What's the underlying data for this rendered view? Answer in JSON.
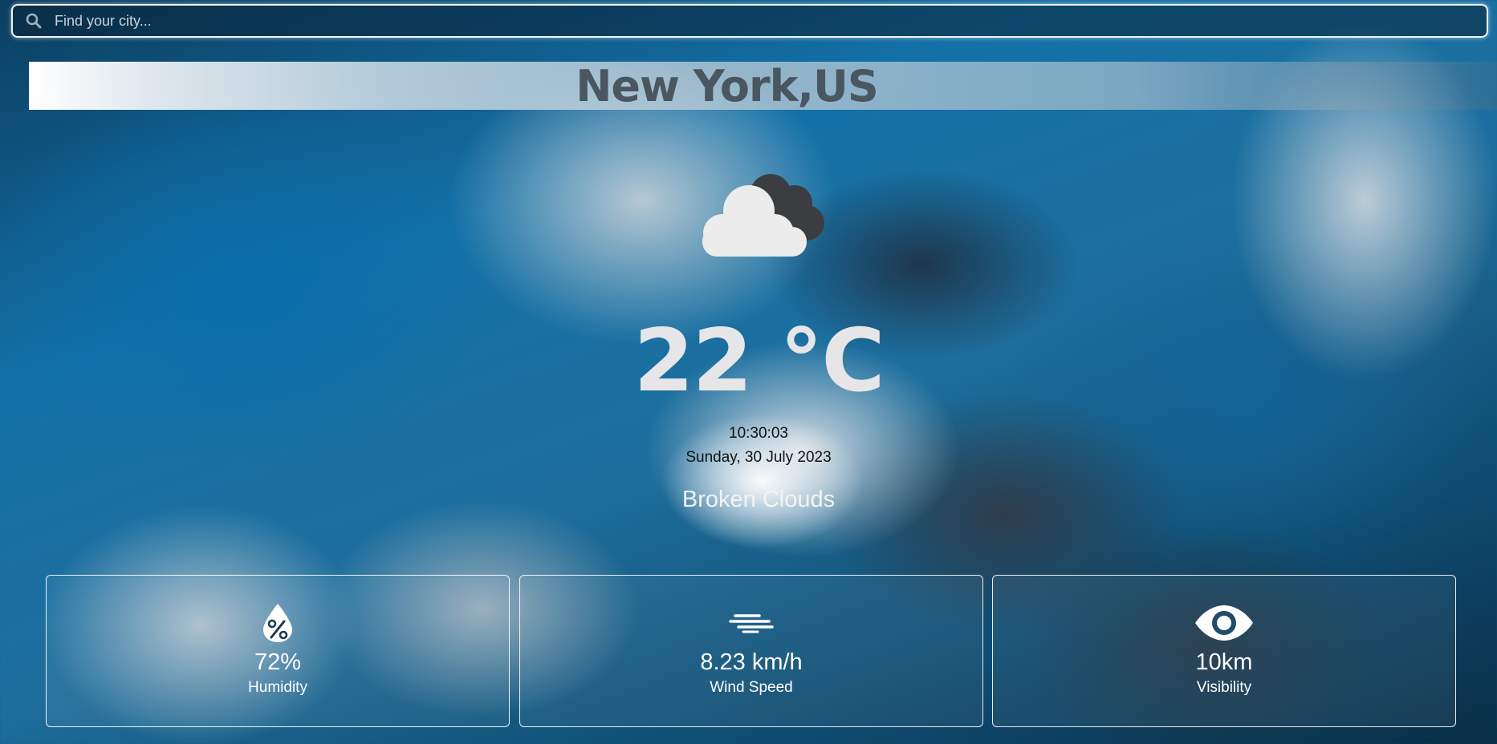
{
  "search": {
    "placeholder": "Find your city...",
    "value": ""
  },
  "location": {
    "city": "New York,US"
  },
  "current": {
    "icon": "broken-clouds-icon",
    "temperature": "22 °C",
    "time": "10:30:03",
    "date": "Sunday, 30 July 2023",
    "description": "Broken Clouds"
  },
  "stats": [
    {
      "icon": "humidity-icon",
      "value": "72%",
      "label": "Humidity"
    },
    {
      "icon": "wind-icon",
      "value": "8.23 km/h",
      "label": "Wind Speed"
    },
    {
      "icon": "eye-icon",
      "value": "10km",
      "label": "Visibility"
    }
  ],
  "colors": {
    "accent_text": "#4a5760",
    "temperature_text": "#e6e6e8",
    "card_border": "#ffffff"
  }
}
